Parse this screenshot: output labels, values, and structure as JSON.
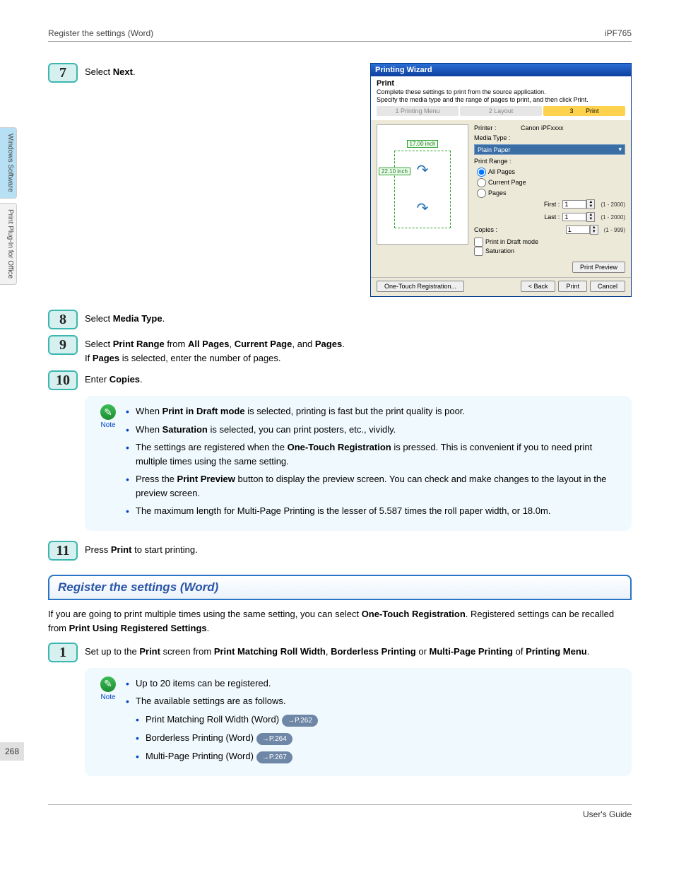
{
  "header": {
    "left": "Register the settings (Word)",
    "right": "iPF765"
  },
  "sideTabs": {
    "tab1": "Windows Software",
    "tab2": "Print Plug-In for Office"
  },
  "steps": {
    "s7": {
      "num": "7",
      "pre": "Select ",
      "bold": "Next",
      "post": "."
    },
    "s8": {
      "num": "8",
      "pre": "Select ",
      "bold": "Media Type",
      "post": "."
    },
    "s9": {
      "num": "9",
      "l1_a": "Select ",
      "l1_b": "Print Range",
      "l1_c": " from ",
      "l1_d": "All Pages",
      "l1_e": ", ",
      "l1_f": "Current Page",
      "l1_g": ", and ",
      "l1_h": "Pages",
      "l1_i": ".",
      "l2_a": "If ",
      "l2_b": "Pages",
      "l2_c": " is selected, enter the number of pages."
    },
    "s10": {
      "num": "10",
      "pre": "Enter ",
      "bold": "Copies",
      "post": "."
    },
    "s11": {
      "num": "11",
      "pre": "Press ",
      "bold": "Print",
      "post": " to start printing."
    },
    "s1": {
      "num": "1",
      "a": "Set up to the ",
      "b": "Print",
      "c": " screen from ",
      "d": "Print Matching Roll Width",
      "e": ", ",
      "f": "Borderless Printing",
      "g": " or ",
      "h": "Multi-Page Printing",
      "i": " of ",
      "j": "Printing Menu",
      "k": "."
    }
  },
  "note1": {
    "label": "Note",
    "b1a": "When ",
    "b1b": "Print in Draft mode",
    "b1c": " is selected, printing is fast but the print quality is poor.",
    "b2a": "When ",
    "b2b": "Saturation",
    "b2c": " is selected, you can print posters, etc., vividly.",
    "b3a": "The settings are registered when the ",
    "b3b": "One-Touch Registration",
    "b3c": " is pressed. This is convenient if you to need print multiple times using the same setting.",
    "b4a": "Press the ",
    "b4b": "Print Preview",
    "b4c": " button to display the preview screen. You can check and make changes to the layout in the preview screen.",
    "b5": "The maximum length for Multi-Page Printing is the lesser of 5.587 times the roll paper width, or 18.0m."
  },
  "section": {
    "title": "Register the settings (Word)"
  },
  "introA": "If you are going to print multiple times using the same setting, you can select ",
  "introB": "One-Touch Registration",
  "introC": ". Registered settings can be recalled from ",
  "introD": "Print Using Registered Settings",
  "introE": ".",
  "note2": {
    "label": "Note",
    "b1": "Up to 20 items can be registered.",
    "b2": "The available settings are as follows.",
    "sub1": "Print Matching Roll Width (Word)",
    "sub1ref": "→P.262",
    "sub2": "Borderless Printing (Word)",
    "sub2ref": "→P.264",
    "sub3": "Multi-Page Printing (Word)",
    "sub3ref": "→P.267"
  },
  "dialog": {
    "title": "Printing Wizard",
    "headMain": "Print",
    "headSub1": "Complete these settings to print from the source application.",
    "headSub2": "Specify the media type and the range of pages to print, and then click Print.",
    "tab1": "1       Printing Menu",
    "tab2": "2          Layout",
    "tab3n": "3",
    "tab3": "Print",
    "dimTop": "17.00 inch",
    "dimSide": "22.10 inch",
    "printerLbl": "Printer :",
    "printerVal": "Canon iPFxxxx",
    "mediaLbl": "Media Type :",
    "mediaVal": "Plain Paper",
    "rangeLbl": "Print Range :",
    "optAll": "All Pages",
    "optCur": "Current Page",
    "optPages": "Pages",
    "firstLbl": "First :",
    "lastLbl": "Last :",
    "spin1": "1",
    "spin2": "1",
    "rangeTxt": "(1 - 2000)",
    "copiesLbl": "Copies :",
    "copiesVal": "1",
    "copiesRange": "(1 - 999)",
    "chkDraft": "Print in Draft mode",
    "chkSat": "Saturation",
    "btnPreview": "Print Preview",
    "btnReg": "One-Touch Registration...",
    "btnBack": "< Back",
    "btnPrint": "Print",
    "btnCancel": "Cancel"
  },
  "pageNum": "268",
  "footer": "User's Guide"
}
